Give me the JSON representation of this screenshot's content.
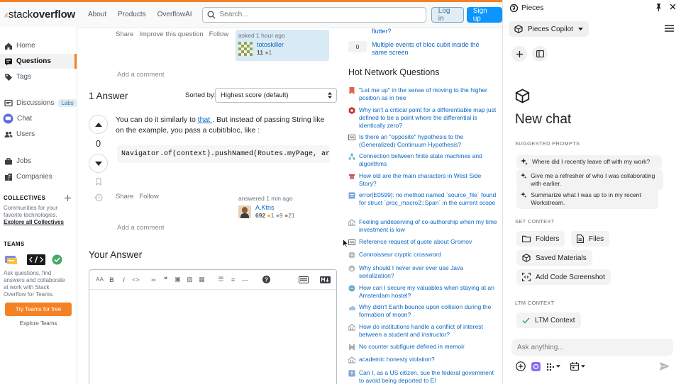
{
  "so": {
    "brand": {
      "word_a": "stack",
      "word_b": "overflow"
    },
    "topnav": [
      "About",
      "Products",
      "OverflowAI"
    ],
    "search_placeholder": "Search...",
    "login": "Log in",
    "signup": "Sign up",
    "left_nav": {
      "home": "Home",
      "questions": "Questions",
      "tags": "Tags",
      "discussions": "Discussions",
      "labs": "Labs",
      "chat": "Chat",
      "users": "Users",
      "jobs": "Jobs",
      "companies": "Companies"
    },
    "collectives": {
      "title": "COLLECTIVES",
      "desc_1": "Communities for your",
      "desc_2": "favorite technologies.",
      "link": "Explore all Collectives"
    },
    "teams": {
      "title": "TEAMS",
      "desc_1": "Ask questions, find",
      "desc_2": "answers and collaborate",
      "desc_3": "at work with Stack",
      "desc_4": "Overflow for Teams.",
      "cta": "Try Teams for free",
      "explore": "Explore Teams"
    },
    "question": {
      "share": "Share",
      "improve": "Improve this question",
      "follow": "Follow",
      "asked": "asked 1 hour ago",
      "user": "totoskiller",
      "rep": "11",
      "bronze": "1",
      "add_comment": "Add a comment"
    },
    "answers": {
      "header": "1 Answer",
      "sorted_by": "Sorted by:",
      "sort_value": "Highest score (default)",
      "vote_count": "0",
      "text_a": "You can do it similarly to ",
      "text_link": "that ",
      "text_b": ". But instead of passing String like on the example, you pass a cubit/bloc, like :",
      "code": "Navigator.of(context).pushNamed(Routes.myPage, arguments",
      "share": "Share",
      "follow": "Follow",
      "answered": "answered 1 min ago",
      "user": "A.Ktns",
      "rep": "692",
      "gold": "1",
      "silver": "9",
      "bronze": "21",
      "add_comment": "Add a comment"
    },
    "your_answer": "Your Answer",
    "related": [
      {
        "count": "",
        "title": "flutter?"
      },
      {
        "count": "0",
        "title": "Multiple events of bloc cubit inside the same screen"
      }
    ],
    "hnq_title": "Hot Network Questions",
    "hnq": [
      "\"Let me up\" in the sense of moving to the higher position as in tree",
      "Why isn't a critical point for a differentiable map just defined to be a point where the differential is identically zero?",
      "Is there an \"opposite\" hypothesis to the (Generalized) Continuum Hypothesis?",
      "Connection between finite state machines and algorithms",
      "How old are the main characters in West Side Story?",
      "error[E0599]: no method named `source_file` found for struct `proc_macro2::Span` in the current scope",
      "Feeling undeserving of co-authorship when my time investment is low",
      "Reference request of quote about Gromov",
      "Connoisseur cryptic crossword",
      "Why should I never ever ever use Java serialization?",
      "How can I secure my valuables when staying at an Amsterdam hostel?",
      "Why didn't Earth bounce upon collision during the formation of moon?",
      "How do institutions handle a conflict of interest between a student and instructor?",
      "No counter subfigure defined in memoir",
      "academic honesty violation?",
      "Can I, as a US citizen, sue the federal government to avoid being deported to El"
    ],
    "colors": {
      "accent": "#f48225",
      "link": "#0a67c2",
      "primary": "#0a95ff"
    }
  },
  "pieces": {
    "title": "Pieces",
    "copilot": "Pieces Copilot",
    "new_chat": "New chat",
    "suggested": "SUGGESTED PROMPTS",
    "prompts": [
      "Where did I recently leave off with my work?",
      "Give me a refresher of who I was collaborating with earlier.",
      "Summarize what I was up to in my recent Workstream."
    ],
    "set_context": "SET CONTEXT",
    "ctx": {
      "folders": "Folders",
      "files": "Files",
      "saved": "Saved Materials",
      "screenshot": "Add Code Screenshot"
    },
    "ltm_title": "LTM CONTEXT",
    "ltm_btn": "LTM Context",
    "ask_placeholder": "Ask anything..."
  }
}
